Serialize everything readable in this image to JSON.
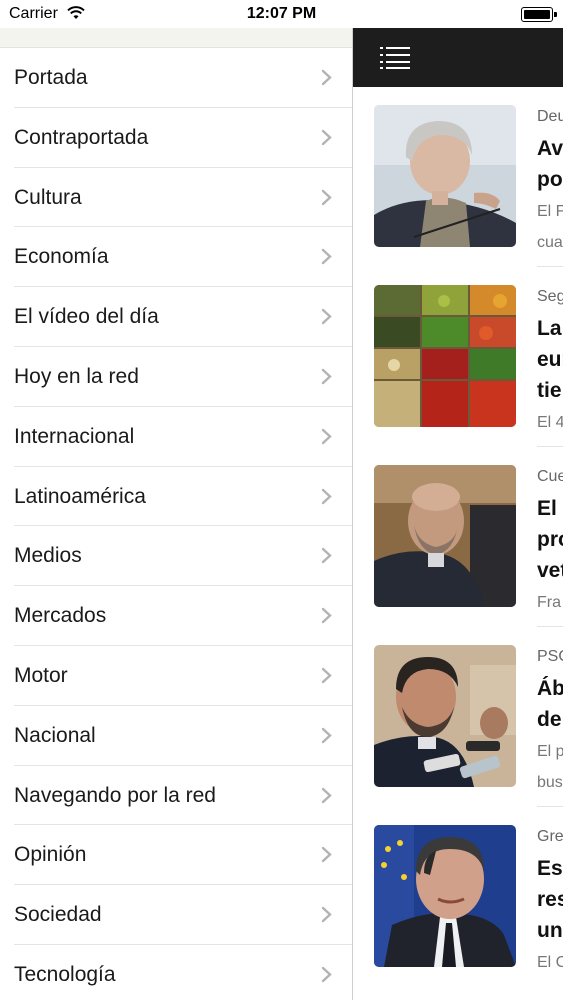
{
  "status_bar": {
    "carrier": "Carrier",
    "time": "12:07 PM"
  },
  "menu": {
    "items": [
      "Portada",
      "Contraportada",
      "Cultura",
      "Economía",
      "El vídeo del día",
      "Hoy en la red",
      "Internacional",
      "Latinoamérica",
      "Medios",
      "Mercados",
      "Motor",
      "Nacional",
      "Navegando por la red",
      "Opinión",
      "Sociedad",
      "Tecnología"
    ]
  },
  "articles": [
    {
      "section": "Deu",
      "title_lines": [
        "Avi",
        "po"
      ],
      "summary_lines": [
        "El F",
        "cua"
      ]
    },
    {
      "section": "Seg",
      "title_lines": [
        "La",
        "eur",
        "tie"
      ],
      "summary_lines": [
        "El 4"
      ]
    },
    {
      "section": "Cue",
      "title_lines": [
        "El l",
        "pro",
        "vet"
      ],
      "summary_lines": [
        "Fra"
      ]
    },
    {
      "section": "PSO",
      "title_lines": [
        "Áb",
        "de"
      ],
      "summary_lines": [
        "El p",
        "bus"
      ]
    },
    {
      "section": "Gre",
      "title_lines": [
        "Esp",
        "res",
        "un"
      ],
      "summary_lines": [
        "El C"
      ]
    }
  ]
}
